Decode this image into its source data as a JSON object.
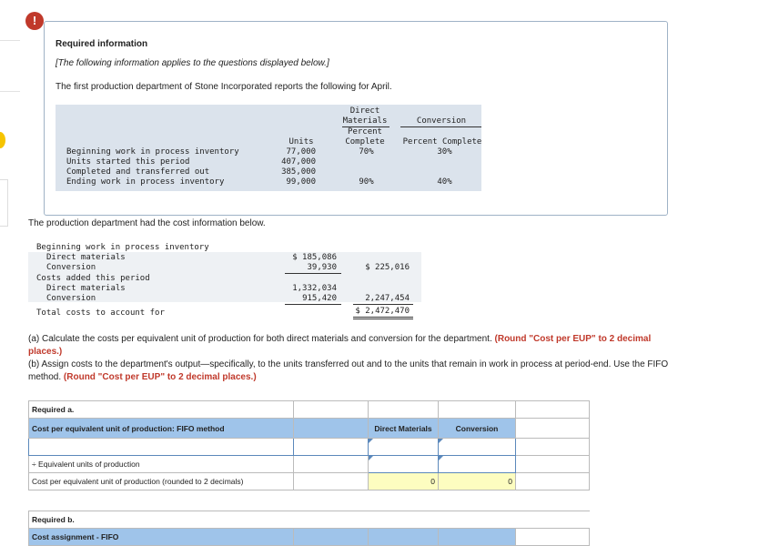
{
  "alert_icon": "!",
  "info": {
    "title": "Required information",
    "subtitle": "[The following information applies to the questions displayed below.]",
    "intro": "The first production department of Stone Incorporated reports the following for April."
  },
  "units_table": {
    "headers": {
      "units": "Units",
      "direct_materials": "Direct Materials",
      "dm_percent": "Percent Complete",
      "conversion": "Conversion",
      "conv_percent": "Percent Complete"
    },
    "rows": [
      {
        "label": "Beginning work in process inventory",
        "units": "77,000",
        "dm": "70%",
        "conv": "30%"
      },
      {
        "label": "Units started this period",
        "units": "407,000",
        "dm": "",
        "conv": ""
      },
      {
        "label": "Completed and transferred out",
        "units": "385,000",
        "dm": "",
        "conv": ""
      },
      {
        "label": "Ending work in process inventory",
        "units": "99,000",
        "dm": "90%",
        "conv": "40%"
      }
    ]
  },
  "cost_info": {
    "intro": "The production department had the cost information below.",
    "beginning_label": "Beginning work in process inventory",
    "dm_label": "Direct materials",
    "conv_label": "Conversion",
    "added_label": "Costs added this period",
    "dm2_label": "Direct materials",
    "conv2_label": "Conversion",
    "total_label": "Total costs to account for",
    "beg_dm": "$ 185,086",
    "beg_conv": "39,930",
    "beg_total": "$ 225,016",
    "add_dm": "1,332,034",
    "add_conv": "915,420",
    "add_total": "2,247,454",
    "grand_total": "$ 2,472,470"
  },
  "question": {
    "a_text": "(a) Calculate the costs per equivalent unit of production for both direct materials and conversion for the department.",
    "a_bold": "(Round \"Cost per EUP\" to 2 decimal places.)",
    "b_text": "(b) Assign costs to the department's output—specifically, to the units transferred out and to the units that remain in work in process at period-end. Use the FIFO method.",
    "b_bold": "(Round \"Cost per EUP\" to 2 decimal places.)"
  },
  "required_a": {
    "label": "Required a.",
    "header": "Cost per equivalent unit of production: FIFO method",
    "col_dm": "Direct Materials",
    "col_conv": "Conversion",
    "eq_units_label": "÷ Equivalent units of production",
    "cost_per_label": "Cost per equivalent unit of production (rounded to 2 decimals)",
    "dm_value": "0",
    "conv_value": "0"
  },
  "required_b": {
    "label": "Required b.",
    "header": "Cost assignment - FIFO"
  },
  "colors": {
    "alert": "#c0392b",
    "header_blue": "#9fc4ea",
    "yellow": "#fdfdc0",
    "shade": "#dbe3ec"
  }
}
